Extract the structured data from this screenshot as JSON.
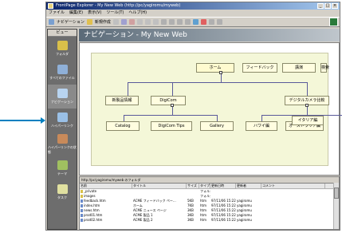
{
  "title_bar": {
    "text": "FrontPage Explorer - My New Web (http://pc/yagiromu/myweb)"
  },
  "menu": [
    "ファイル",
    "編集(E)",
    "表示(V)",
    "ツール(T)",
    "ヘルプ(H)"
  ],
  "toolbar": {
    "buttons": [
      "ナビゲーション",
      "新規作成"
    ]
  },
  "views_pane": {
    "header": "ビュー",
    "items": [
      {
        "label": "フォルダ",
        "color": "#d9c04a"
      },
      {
        "label": "すべてのファイル",
        "color": "#8fb0d8"
      },
      {
        "label": "ナビゲーション",
        "color": "#b8d4f0"
      },
      {
        "label": "ハイパーリンク",
        "color": "#9ac0e6"
      },
      {
        "label": "ハイパーリンクの状態",
        "color": "#c88a5a"
      },
      {
        "label": "テーマ",
        "color": "#a0c060"
      },
      {
        "label": "タスク",
        "color": "#e0e0a0"
      }
    ],
    "active_index": 2
  },
  "banner": {
    "text": "ナビゲーション - My New Web"
  },
  "navigation": {
    "nodes": {
      "home": "ホーム",
      "feedback": "フィードバック",
      "seminar": "講演",
      "search": "検索",
      "product_info": "新製品情報",
      "digicom": "DigiCom",
      "support": "デジタルカメラ比較",
      "catalog": "Catalog",
      "digicom_tips": "DigiCom Tips",
      "gallery": "Gallery",
      "hawaii": "ハワイ編",
      "australia": "オーストラリア編",
      "italy": "イタリア編"
    }
  },
  "file_list": {
    "path": "http://pc/yagiromu/myweb のフォルダ",
    "columns": [
      "名前",
      "タイトル",
      "サイズ",
      "タイプ",
      "更新日時",
      "更新者",
      "コメント"
    ],
    "rows": [
      {
        "name": "_private",
        "title": "",
        "size": "",
        "type": "フォルダ",
        "modified": "",
        "by": "",
        "icon": "folder"
      },
      {
        "name": "images",
        "title": "",
        "size": "",
        "type": "フォルダ",
        "modified": "",
        "by": "",
        "icon": "folder"
      },
      {
        "name": "feedback.htm",
        "title": "ACME フィードバック ペー...",
        "size": "5KB",
        "type": "htm",
        "modified": "97/11/06 15:22:19",
        "by": "yagiromu",
        "icon": "page"
      },
      {
        "name": "index.htm",
        "title": "ホーム",
        "size": "7KB",
        "type": "htm",
        "modified": "97/11/06 15:22:19",
        "by": "yagiromu",
        "icon": "page"
      },
      {
        "name": "news.htm",
        "title": "ACME ニュース ページ",
        "size": "3KB",
        "type": "htm",
        "modified": "97/11/06 15:22:19",
        "by": "yagiromu",
        "icon": "page"
      },
      {
        "name": "prod01.htm",
        "title": "ACME 製品 1",
        "size": "3KB",
        "type": "htm",
        "modified": "97/11/06 15:22:19",
        "by": "yagiromu",
        "icon": "page"
      },
      {
        "name": "prod02.htm",
        "title": "ACME 製品 2",
        "size": "3KB",
        "type": "htm",
        "modified": "97/11/06 15:22:19",
        "by": "yagiromu",
        "icon": "page"
      }
    ]
  }
}
